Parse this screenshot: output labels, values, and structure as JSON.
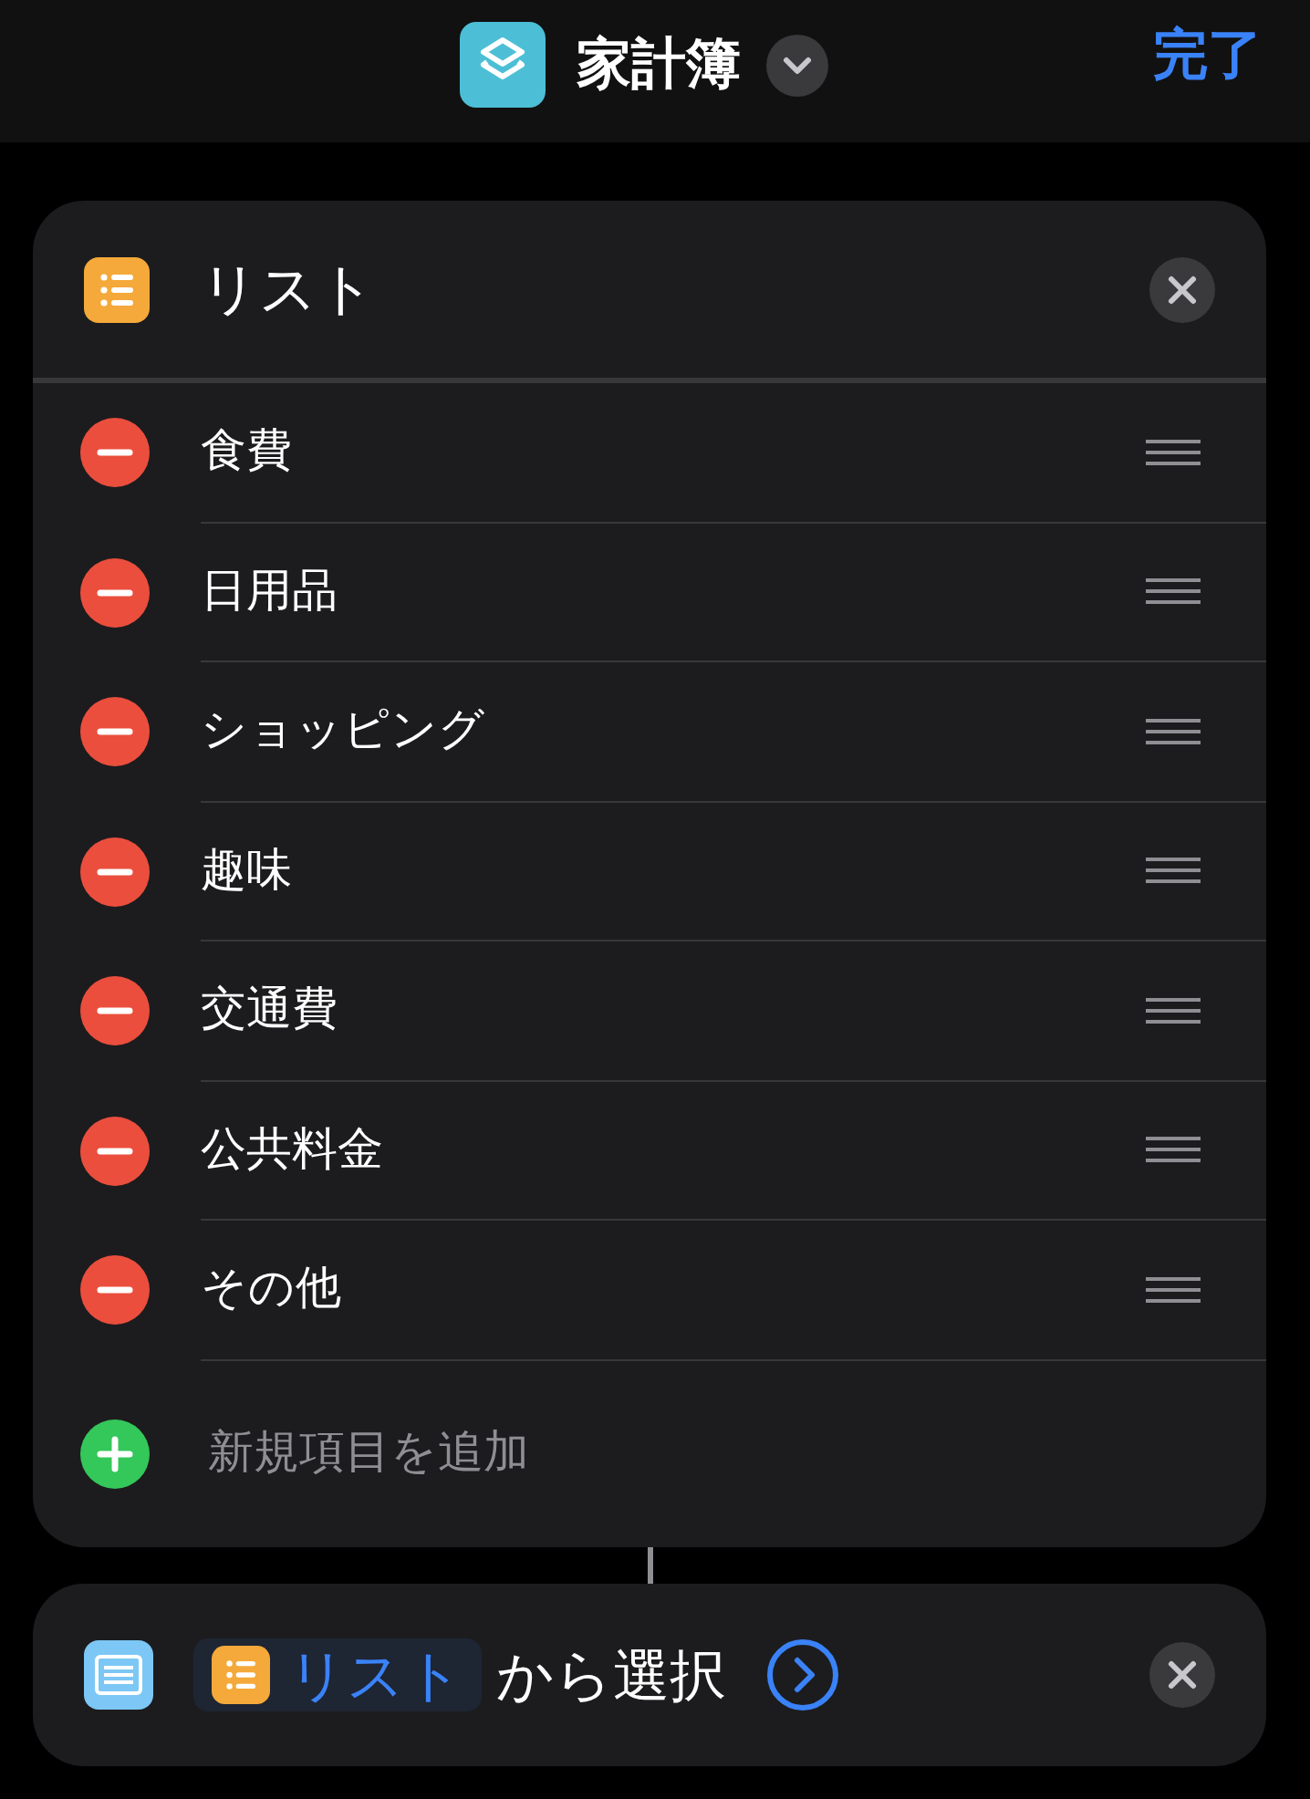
{
  "header": {
    "title": "家計簿",
    "done": "完了"
  },
  "list_action": {
    "title": "リスト",
    "items": [
      {
        "label": "食費"
      },
      {
        "label": "日用品"
      },
      {
        "label": "ショッピング"
      },
      {
        "label": "趣味"
      },
      {
        "label": "交通費"
      },
      {
        "label": "公共料金"
      },
      {
        "label": "その他"
      }
    ],
    "add_placeholder": "新規項目を追加"
  },
  "choose_action": {
    "variable": "リスト",
    "text": "から選択"
  }
}
